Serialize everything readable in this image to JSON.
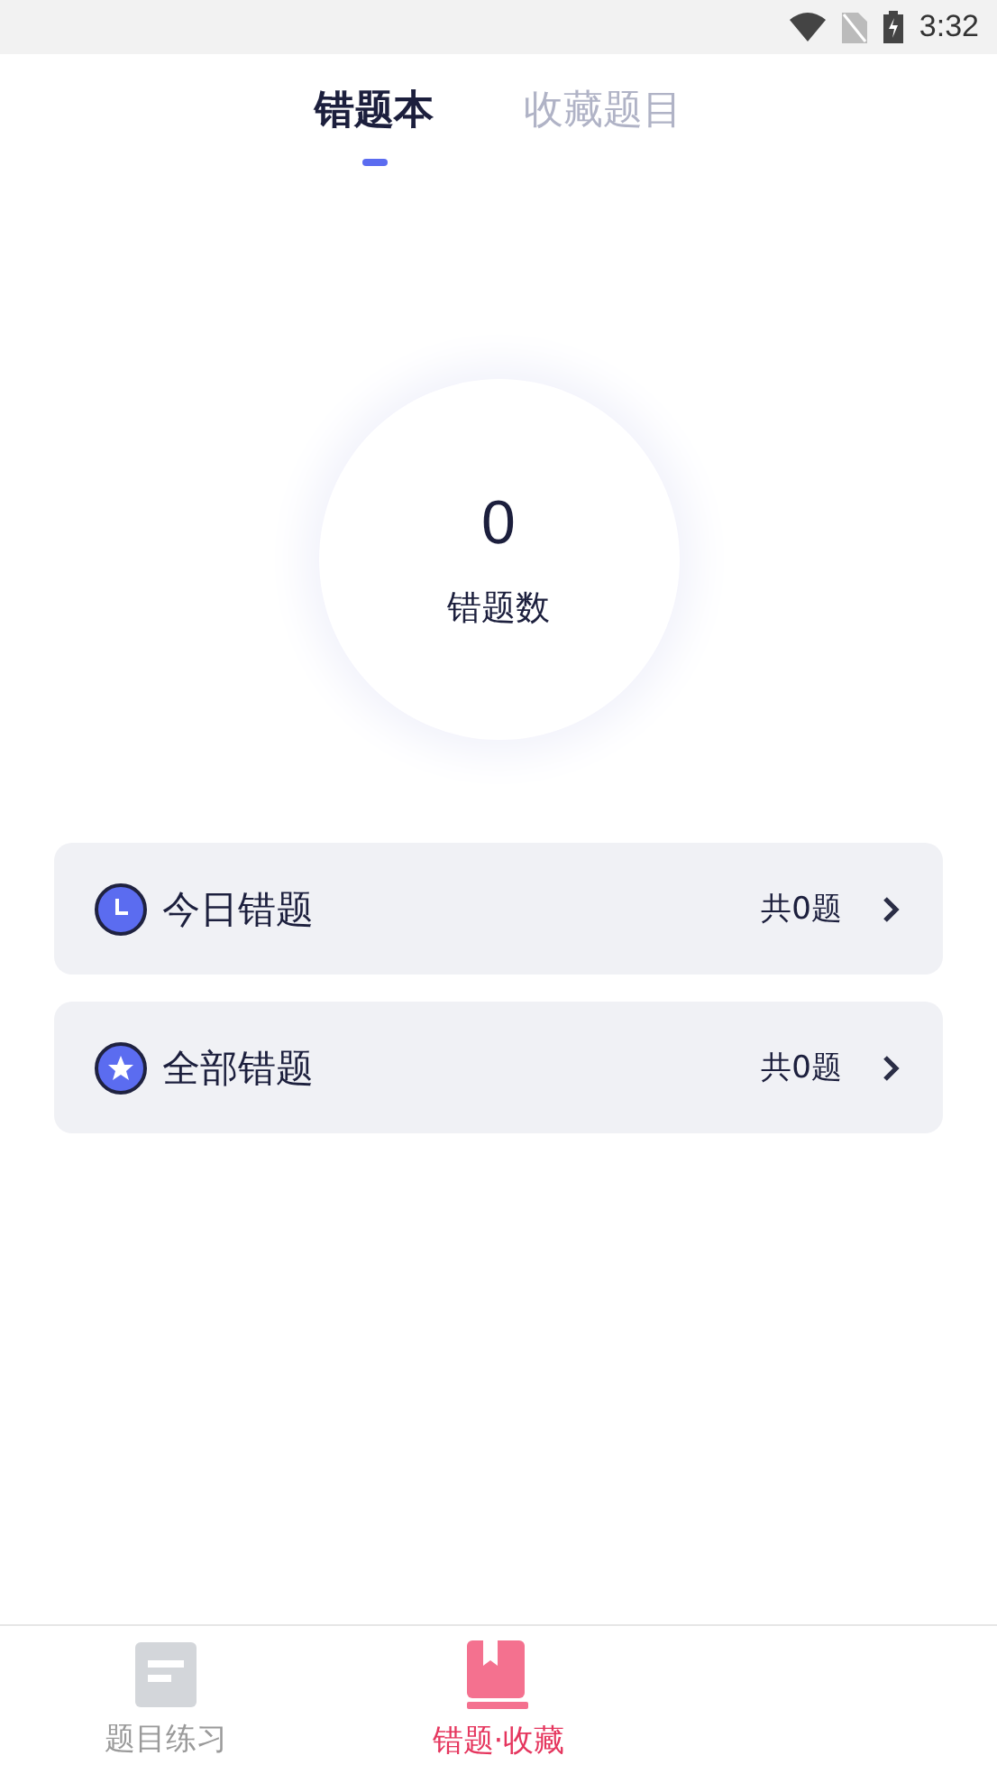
{
  "status_bar": {
    "time": "3:32"
  },
  "tabs": [
    {
      "label": "错题本",
      "selected": true
    },
    {
      "label": "收藏题目",
      "selected": false
    }
  ],
  "summary": {
    "count": "0",
    "label": "错题数"
  },
  "lists": [
    {
      "kind": "clock",
      "title": "今日错题",
      "count": "共0题"
    },
    {
      "kind": "star",
      "title": "全部错题",
      "count": "共0题"
    }
  ],
  "bottom_nav": [
    {
      "kind": "doc",
      "label": "题目练习",
      "selected": false
    },
    {
      "kind": "book",
      "label": "错题·收藏",
      "selected": true
    }
  ]
}
